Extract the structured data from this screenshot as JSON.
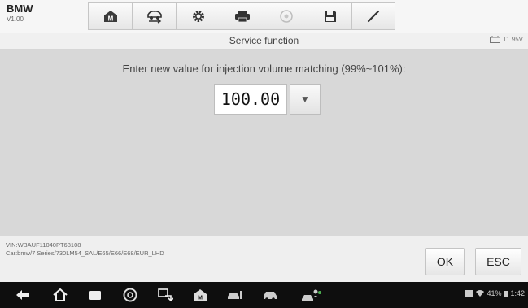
{
  "app": {
    "name": "BMW",
    "version": "V1.00"
  },
  "toolbar": {
    "buttons": [
      "home-icon",
      "vehicle-swap-icon",
      "settings-icon",
      "printer-icon",
      "disc-icon",
      "save-icon",
      "pen-icon"
    ]
  },
  "header": {
    "title": "Service function",
    "battery": "11.95V"
  },
  "main": {
    "prompt": "Enter new value for injection volume matching (99%~101%):",
    "value": "100.00"
  },
  "footer": {
    "vin": "VIN:WBAUF11040PT68108",
    "car": "Car:bmw/7 Series/730LM54_SAL/E65/E66/E68/EUR_LHD",
    "ok_label": "OK",
    "esc_label": "ESC"
  },
  "android": {
    "status_battery": "41%",
    "time": "1:42",
    "nav": [
      "back-icon",
      "home-icon",
      "recents-icon",
      "chrome-icon",
      "remote-icon",
      "maxisys-icon",
      "car-icon",
      "car-side-icon",
      "people-icon"
    ]
  }
}
